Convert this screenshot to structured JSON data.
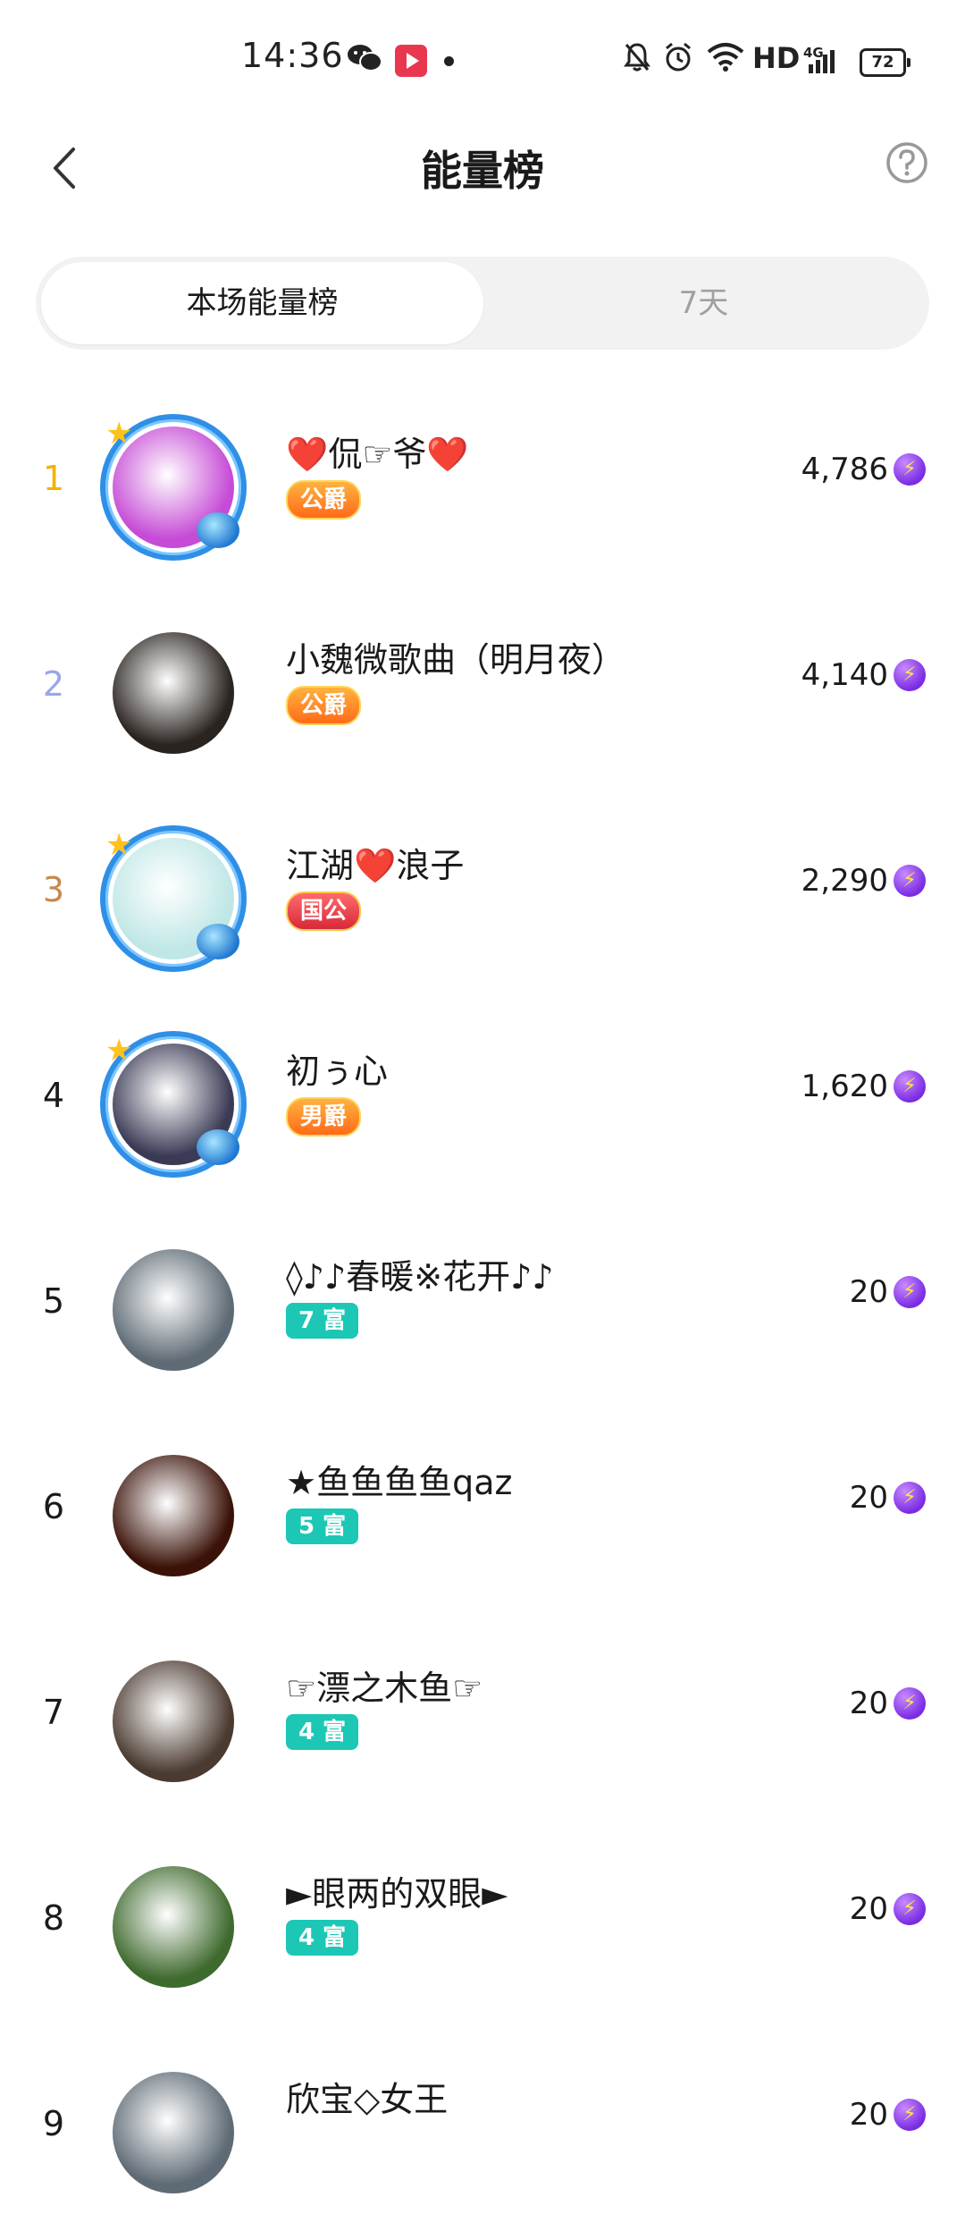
{
  "status_bar": {
    "time": "14:36",
    "network": "HD",
    "signal_type": "4G",
    "battery": "72"
  },
  "header": {
    "title": "能量榜",
    "back_icon": "chevron-left-icon",
    "help_icon": "question-circle-icon"
  },
  "tabs": [
    {
      "label": "本场能量榜",
      "active": true
    },
    {
      "label": "7天",
      "active": false
    }
  ],
  "rank_colors": {
    "1": "#f2b400",
    "2": "#9aa6e8",
    "3": "#c8884a",
    "default": "#1a1a1a"
  },
  "ranking": [
    {
      "rank": "1",
      "name": "❤️侃☞爷❤️",
      "badge": "公爵",
      "badge_type": "noble",
      "score": "4,786",
      "framed": true,
      "avatar_color": "#c64bd6"
    },
    {
      "rank": "2",
      "name": "小魏微歌曲（明月夜）",
      "badge": "公爵",
      "badge_type": "noble",
      "score": "4,140",
      "framed": false,
      "avatar_color": "#2a2420"
    },
    {
      "rank": "3",
      "name": "江湖❤️浪子",
      "badge": "国公",
      "badge_type": "guogong",
      "score": "2,290",
      "framed": true,
      "avatar_color": "#bfe7e6"
    },
    {
      "rank": "4",
      "name": "初ぅ心",
      "badge": "男爵",
      "badge_type": "noble",
      "score": "1,620",
      "framed": true,
      "avatar_color": "#3a3a55"
    },
    {
      "rank": "5",
      "name": "◊♪♪春暖※花开♪♪",
      "badge": "7 富",
      "badge_type": "rich",
      "score": "20",
      "framed": false,
      "avatar_color": "#5e6a74"
    },
    {
      "rank": "6",
      "name": "★鱼鱼鱼鱼qaz",
      "badge": "5 富",
      "badge_type": "rich",
      "score": "20",
      "framed": false,
      "avatar_color": "#3a1208"
    },
    {
      "rank": "7",
      "name": "☞漂之木鱼☞",
      "badge": "4 富",
      "badge_type": "rich",
      "score": "20",
      "framed": false,
      "avatar_color": "#4a3a30"
    },
    {
      "rank": "8",
      "name": "►眼两的双眼►",
      "badge": "4 富",
      "badge_type": "rich",
      "score": "20",
      "framed": false,
      "avatar_color": "#3f6a2e"
    },
    {
      "rank": "9",
      "name": "欣宝◇女王",
      "badge": "",
      "badge_type": "rich",
      "score": "20",
      "framed": false,
      "avatar_color": "#5e6a74"
    }
  ]
}
